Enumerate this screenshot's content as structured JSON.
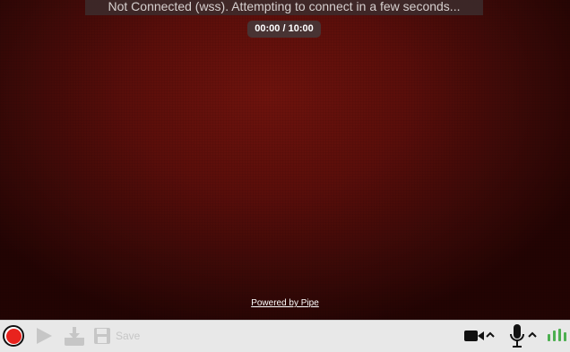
{
  "status": {
    "message": "Not Connected (wss). Attempting to connect in a few seconds..."
  },
  "timer": {
    "text": "00:00 / 10:00"
  },
  "branding": {
    "powered_by": "Powered by Pipe"
  },
  "controls": {
    "save_label": "Save",
    "icons": [
      "record-icon",
      "play-icon",
      "download-icon",
      "save-icon",
      "camera-icon",
      "chevron-up-icon",
      "microphone-icon",
      "chevron-up-icon",
      "audio-level-icon"
    ],
    "mic_level": 1.0
  },
  "colors": {
    "record": "#e8231e",
    "disabled": "#c6c6c6",
    "level": "#4caf50",
    "stage": "#5a0e0a"
  }
}
